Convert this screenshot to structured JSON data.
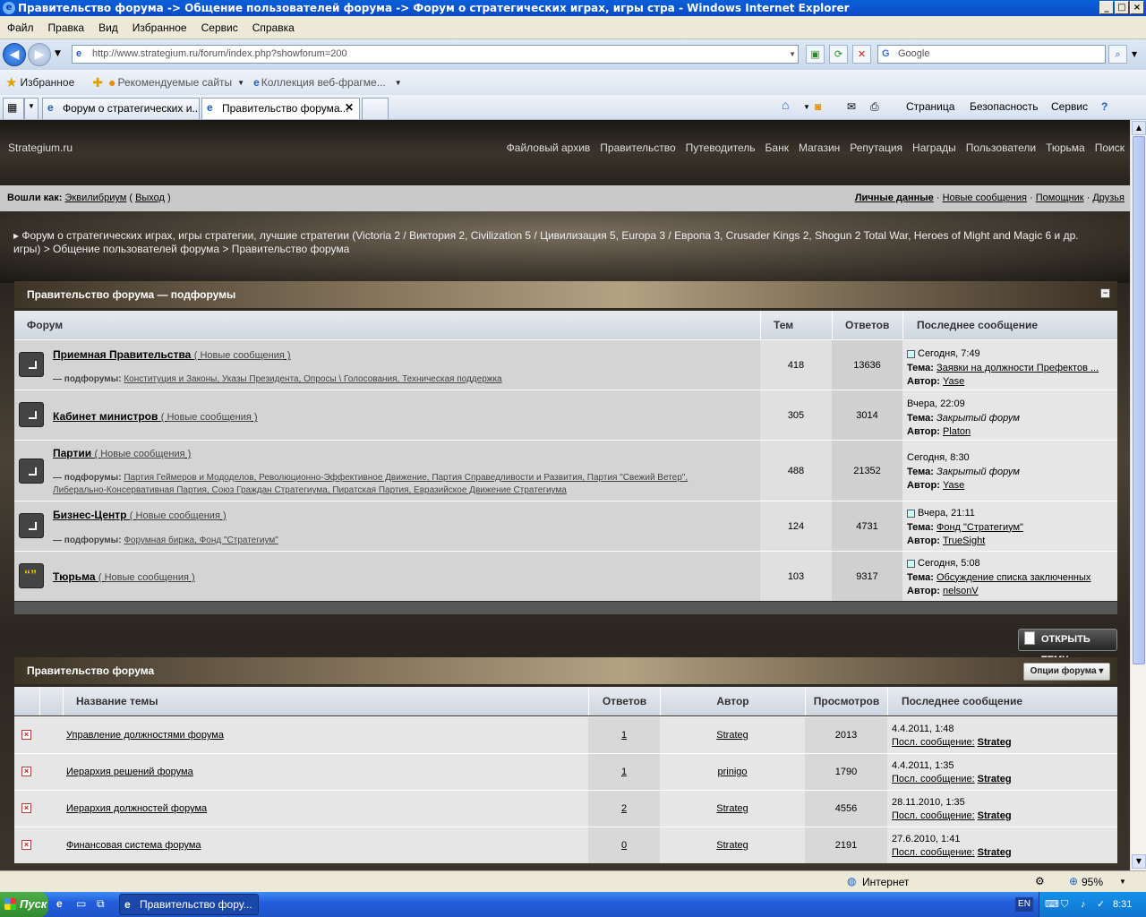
{
  "window": {
    "title": "Правительство форума -> Общение пользователей форума -> Форум о стратегических играх, игры стра - Windows Internet Explorer"
  },
  "menu": [
    "Файл",
    "Правка",
    "Вид",
    "Избранное",
    "Сервис",
    "Справка"
  ],
  "address": {
    "url": "http://www.strategium.ru/forum/index.php?showforum=200",
    "search_placeholder": "Google"
  },
  "favbar": {
    "favorites": "Избранное",
    "recommended": "Рекомендуемые сайты",
    "gallery": "Коллекция веб-фрагме..."
  },
  "tabs": [
    {
      "label": "Форум о стратегических и..."
    },
    {
      "label": "Правительство форума..."
    }
  ],
  "commandbar": {
    "page": "Страница",
    "safety": "Безопасность",
    "tools": "Сервис"
  },
  "site": {
    "name": "Strategium.ru",
    "nav": [
      "Файловый архив",
      "Правительство",
      "Путеводитель",
      "Банк",
      "Магазин",
      "Репутация",
      "Награды",
      "Пользователи",
      "Тюрьма",
      "Поиск"
    ],
    "logged_as": "Вошли как:",
    "username": "Эквилибриум",
    "logout": "Выход",
    "user_links": [
      "Личные данные",
      "Новые сообщения",
      "Помощник",
      "Друзья"
    ],
    "breadcrumb": "Форум о стратегических играх, игры стратегии, лучшие стратегии (Victoria 2 / Виктория 2, Civilization 5 / Цивилизация 5, Europa 3 / Европа 3, Crusader Kings 2, Shogun 2 Total War, Heroes of Might and Magic 6 и др. игры) > Общение пользователей форума > Правительство форума"
  },
  "subforums": {
    "title": "Правительство форума — подфорумы",
    "columns": {
      "forum": "Форум",
      "topics": "Тем",
      "replies": "Ответов",
      "last": "Последнее сообщение"
    },
    "new_label": "Новые сообщения",
    "sub_label": "— подфорумы:",
    "topic_label": "Тема:",
    "author_label": "Автор:",
    "rows": [
      {
        "name": "Приемная Правительства",
        "subs": "Конституция и Законы, Указы Президента, Опросы \\ Голосования, Техническая поддержка",
        "topics": "418",
        "replies": "13636",
        "date": "Сегодня, 7:49",
        "topic": "Заявки на должности Префектов ...",
        "author": "Yase"
      },
      {
        "name": "Кабинет министров",
        "subs": "",
        "topics": "305",
        "replies": "3014",
        "date": "Вчера, 22:09",
        "topic": "Закрытый форум",
        "author": "Platon"
      },
      {
        "name": "Партии",
        "subs": "Партия Геймеров и Мододелов, Революционно-Эффективное Движение, Партия Справедливости и Развития, Партия \"Свежий Ветер\", Либерально-Консервативная Партия, Союз Граждан Стратегиума, Пиратская Партия, Евразийское Движение Стратегиума",
        "topics": "488",
        "replies": "21352",
        "date": "Сегодня, 8:30",
        "topic": "Закрытый форум",
        "author": "Yase"
      },
      {
        "name": "Бизнес-Центр",
        "subs": "Форумная биржа, Фонд \"Стратегиум\"",
        "topics": "124",
        "replies": "4731",
        "date": "Вчера, 21:11",
        "topic": "Фонд \"Стратегиум\"",
        "author": "TrueSight"
      },
      {
        "name": "Тюрьма",
        "subs": "",
        "topics": "103",
        "replies": "9317",
        "date": "Сегодня, 5:08",
        "topic": "Обсуждение списка заключенных",
        "author": "nelsonV"
      }
    ]
  },
  "topics": {
    "open_button": "ОТКРЫТЬ ТЕМУ",
    "title": "Правительство форума",
    "options_button": "Опции форума",
    "columns": {
      "name": "Название темы",
      "replies": "Ответов",
      "author": "Автор",
      "views": "Просмотров",
      "last": "Последнее сообщение"
    },
    "last_label": "Посл. сообщение:",
    "rows": [
      {
        "title": "Управление должностями форума",
        "replies": "1",
        "author": "Strateg",
        "views": "2013",
        "date": "4.4.2011, 1:48",
        "last_author": "Strateg"
      },
      {
        "title": "Иерархия решений форума",
        "replies": "1",
        "author": "prinigo",
        "views": "1790",
        "date": "4.4.2011, 1:35",
        "last_author": "Strateg"
      },
      {
        "title": "Иерархия должностей форума",
        "replies": "2",
        "author": "Strateg",
        "views": "4556",
        "date": "28.11.2010, 1:35",
        "last_author": "Strateg"
      },
      {
        "title": "Финансовая система форума",
        "replies": "0",
        "author": "Strateg",
        "views": "2191",
        "date": "27.6.2010, 1:41",
        "last_author": "Strateg"
      }
    ]
  },
  "statusbar": {
    "zone": "Интернет",
    "zoom": "95%"
  },
  "taskbar": {
    "start": "Пуск",
    "item": "Правительство фору...",
    "lang": "EN",
    "time": "8:31"
  }
}
